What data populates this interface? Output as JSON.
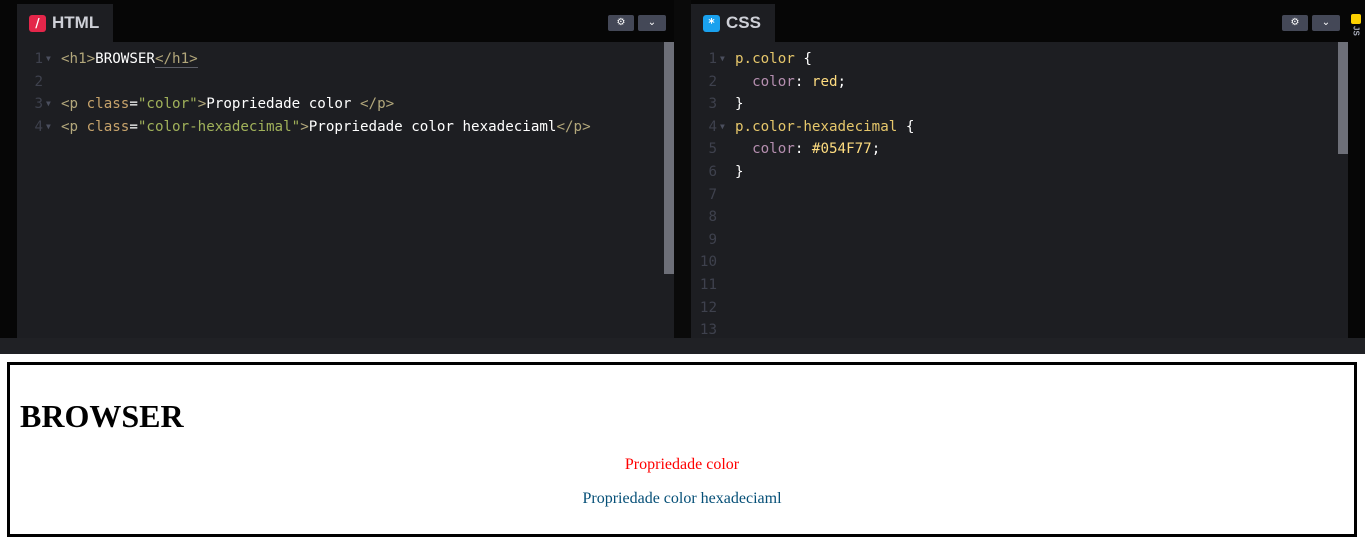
{
  "editors": {
    "html": {
      "tab_label": "HTML",
      "tab_icon": "html-logo-icon",
      "buttons": [
        "gear-icon",
        "chevron-down-icon"
      ],
      "lines": [
        {
          "n": "1",
          "fold": true,
          "tokens": [
            [
              "tag",
              "<h1>"
            ],
            [
              "txt",
              "BROWSER"
            ],
            [
              "tagclose",
              "</h1>"
            ]
          ]
        },
        {
          "n": "2",
          "fold": false,
          "tokens": []
        },
        {
          "n": "3",
          "fold": true,
          "tokens": [
            [
              "tag",
              "<p "
            ],
            [
              "attr",
              "class"
            ],
            [
              "punct",
              "="
            ],
            [
              "str",
              "\"color\""
            ],
            [
              "tag",
              ">"
            ],
            [
              "txt",
              "Propriedade color "
            ],
            [
              "tag",
              "</p>"
            ]
          ]
        },
        {
          "n": "4",
          "fold": true,
          "tokens": [
            [
              "tag",
              "<p "
            ],
            [
              "attr",
              "class"
            ],
            [
              "punct",
              "="
            ],
            [
              "str",
              "\"color-hexadecimal\""
            ],
            [
              "tag",
              ">"
            ],
            [
              "txt",
              "Propriedade color hexadeciaml"
            ],
            [
              "tag",
              "</p>"
            ]
          ]
        }
      ]
    },
    "css": {
      "tab_label": "CSS",
      "tab_icon": "css-logo-icon",
      "buttons": [
        "gear-icon",
        "chevron-down-icon"
      ],
      "lines": [
        {
          "n": "1",
          "fold": true,
          "tokens": [
            [
              "sel",
              "p.color "
            ],
            [
              "punct",
              "{"
            ]
          ]
        },
        {
          "n": "2",
          "fold": false,
          "tokens": [
            [
              "punct",
              "  "
            ],
            [
              "prop",
              "color"
            ],
            [
              "punct",
              ": "
            ],
            [
              "val",
              "red"
            ],
            [
              "punct",
              ";"
            ]
          ]
        },
        {
          "n": "3",
          "fold": false,
          "tokens": [
            [
              "punct",
              "}"
            ]
          ]
        },
        {
          "n": "4",
          "fold": true,
          "tokens": [
            [
              "sel",
              "p.color-hexadecimal "
            ],
            [
              "punct",
              "{"
            ]
          ]
        },
        {
          "n": "5",
          "fold": false,
          "tokens": [
            [
              "punct",
              "  "
            ],
            [
              "prop",
              "color"
            ],
            [
              "punct",
              ": "
            ],
            [
              "val",
              "#054F77"
            ],
            [
              "punct",
              ";"
            ]
          ]
        },
        {
          "n": "6",
          "fold": false,
          "tokens": [
            [
              "punct",
              "}"
            ]
          ]
        },
        {
          "n": "7",
          "fold": false,
          "tokens": []
        },
        {
          "n": "8",
          "fold": false,
          "tokens": []
        },
        {
          "n": "9",
          "fold": false,
          "tokens": []
        },
        {
          "n": "10",
          "fold": false,
          "tokens": []
        },
        {
          "n": "11",
          "fold": false,
          "tokens": []
        },
        {
          "n": "12",
          "fold": false,
          "tokens": []
        },
        {
          "n": "13",
          "fold": false,
          "tokens": []
        }
      ]
    },
    "js_tab_label": "JS"
  },
  "preview": {
    "heading": "BROWSER",
    "p_color": "Propriedade color",
    "p_color_hex": "Propriedade color hexadeciaml",
    "colors": {
      "p_color": "#ff0000",
      "p_color_hex": "#054F77"
    }
  }
}
